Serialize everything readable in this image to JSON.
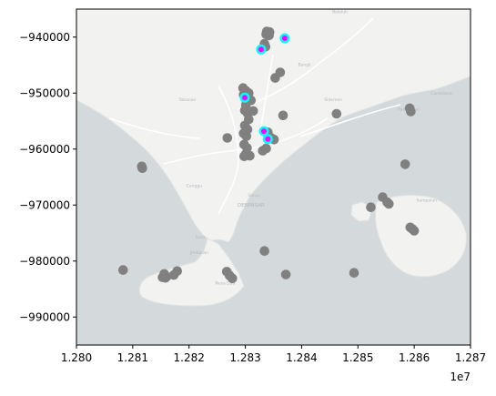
{
  "chart_data": {
    "type": "scatter",
    "title": "",
    "xlabel": "",
    "ylabel": "",
    "xlim": [
      12800000,
      12870000
    ],
    "ylim": [
      -995000,
      -935000
    ],
    "x_offset_text": "1e7",
    "x_ticks": [
      12800000,
      12810000,
      12820000,
      12830000,
      12840000,
      12850000,
      12860000,
      12870000
    ],
    "x_tick_labels": [
      "1.280",
      "1.281",
      "1.282",
      "1.283",
      "1.284",
      "1.285",
      "1.286",
      "1.287"
    ],
    "y_ticks": [
      -940000,
      -950000,
      -960000,
      -970000,
      -980000,
      -990000
    ],
    "y_tick_labels": [
      "−940000",
      "−950000",
      "−960000",
      "−970000",
      "−980000",
      "−990000"
    ],
    "grid": false,
    "legend": "none",
    "basemap": {
      "place_labels": [
        "DENPASAR",
        "Tabanan",
        "Canggu",
        "Sanur",
        "Kuta",
        "Jimbaran",
        "Nusa Dua",
        "Bangli",
        "Sidemen",
        "Candidasa",
        "Padangbai",
        "Sampalan",
        "Belaluh"
      ],
      "colors": {
        "water": "#d4d9dc",
        "land": "#f2f2f1",
        "land_edge": "#e3e5e4",
        "road": "#ffffff",
        "label": "#b3b8bc"
      }
    },
    "series": [
      {
        "role": "all points",
        "color": "#808080",
        "points": [
          [
            12833800,
            -939000
          ],
          [
            12834300,
            -939100
          ],
          [
            12833700,
            -939500
          ],
          [
            12834200,
            -939700
          ],
          [
            12833400,
            -941200
          ],
          [
            12833600,
            -941700
          ],
          [
            12836200,
            -946300
          ],
          [
            12835300,
            -947300
          ],
          [
            12829600,
            -949100
          ],
          [
            12830100,
            -949600
          ],
          [
            12830600,
            -950000
          ],
          [
            12829700,
            -950300
          ],
          [
            12830200,
            -950800
          ],
          [
            12831000,
            -951300
          ],
          [
            12830100,
            -952100
          ],
          [
            12829900,
            -953100
          ],
          [
            12830400,
            -953600
          ],
          [
            12831400,
            -953200
          ],
          [
            12830600,
            -954700
          ],
          [
            12836700,
            -954000
          ],
          [
            12846200,
            -953700
          ],
          [
            12859200,
            -952700
          ],
          [
            12859400,
            -953300
          ],
          [
            12829900,
            -955800
          ],
          [
            12830400,
            -956500
          ],
          [
            12829700,
            -957200
          ],
          [
            12830200,
            -957700
          ],
          [
            12834000,
            -957000
          ],
          [
            12834600,
            -958000
          ],
          [
            12835100,
            -958300
          ],
          [
            12826800,
            -958000
          ],
          [
            12829800,
            -959200
          ],
          [
            12830300,
            -959800
          ],
          [
            12833700,
            -959900
          ],
          [
            12833100,
            -960300
          ],
          [
            12830100,
            -960900
          ],
          [
            12830800,
            -961200
          ],
          [
            12829800,
            -961300
          ],
          [
            12811600,
            -963100
          ],
          [
            12811700,
            -963400
          ],
          [
            12858400,
            -962700
          ],
          [
            12854400,
            -968600
          ],
          [
            12855200,
            -969500
          ],
          [
            12855500,
            -969800
          ],
          [
            12852300,
            -970400
          ],
          [
            12859300,
            -974000
          ],
          [
            12859700,
            -974300
          ],
          [
            12860000,
            -974600
          ],
          [
            12833400,
            -978200
          ],
          [
            12808300,
            -981600
          ],
          [
            12816000,
            -982800
          ],
          [
            12817300,
            -982500
          ],
          [
            12815300,
            -982900
          ],
          [
            12815800,
            -983000
          ],
          [
            12817900,
            -981800
          ],
          [
            12815600,
            -982300
          ],
          [
            12826700,
            -981900
          ],
          [
            12827200,
            -982600
          ],
          [
            12827700,
            -983100
          ],
          [
            12837200,
            -982400
          ],
          [
            12849300,
            -982100
          ]
        ]
      },
      {
        "role": "highlighted points",
        "color": "#ff00ff",
        "ring_color": "#00ffff",
        "points": [
          [
            12837000,
            -940200
          ],
          [
            12832800,
            -942200
          ],
          [
            12829900,
            -950800
          ],
          [
            12833300,
            -956800
          ],
          [
            12834000,
            -958200
          ]
        ]
      }
    ]
  }
}
